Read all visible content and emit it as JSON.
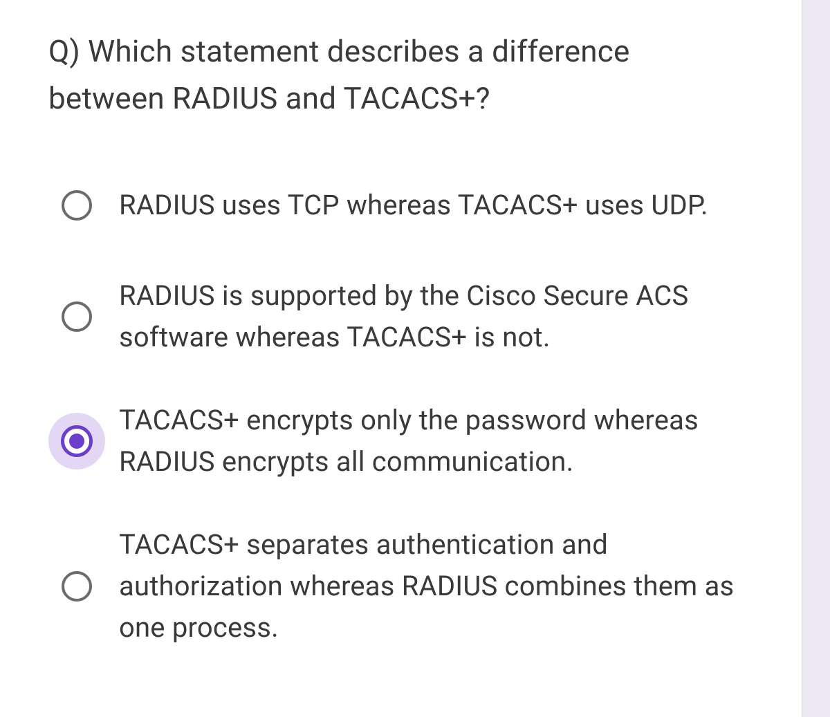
{
  "question": {
    "text": "Q) Which statement describes a difference between RADIUS and TACACS+?"
  },
  "options": [
    {
      "label": "RADIUS uses TCP whereas TACACS+ uses UDP.",
      "selected": false
    },
    {
      "label": "RADIUS is supported by the Cisco Secure ACS software whereas TACACS+ is not.",
      "selected": false
    },
    {
      "label": "TACACS+ encrypts only the password whereas RADIUS encrypts all communication.",
      "selected": true
    },
    {
      "label": "TACACS+ separates authentication and authorization whereas RADIUS combines them as one process.",
      "selected": false
    }
  ],
  "colors": {
    "accent": "#6a3fc9",
    "halo": "#e3d7f5",
    "text": "#3a3a3a",
    "radioBorder": "#6b6b6b",
    "cardBg": "#ffffff",
    "pageBg": "#ede9f5"
  }
}
